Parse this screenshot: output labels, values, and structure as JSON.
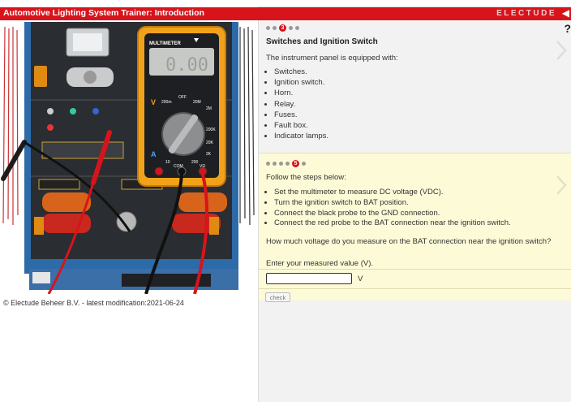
{
  "header": {
    "title": "Automotive Lighting System Trainer: Introduction",
    "brand": "ELECTUDE",
    "help_label": "?"
  },
  "figure": {
    "meter_label": "MULTIMETER",
    "display_value": "0.00",
    "dial_labels": [
      "V",
      "200m",
      "OFF",
      "20M",
      "2M",
      "200K",
      "20K",
      "2K",
      "200",
      "A",
      "10",
      "COM",
      "VΩ"
    ]
  },
  "footer": {
    "copyright": "© Electude Beheer B.V. - latest modification:2021-06-24"
  },
  "panel1": {
    "step_active": "3",
    "heading": "Switches and Ignition Switch",
    "intro": "The instrument panel is equipped with:",
    "items": [
      "Switches.",
      "Ignition switch.",
      "Horn.",
      "Relay.",
      "Fuses.",
      "Fault box.",
      "Indicator lamps."
    ]
  },
  "panel2": {
    "step_active": "5",
    "intro": "Follow the steps below:",
    "steps": [
      "Set the multimeter to measure DC voltage (VDC).",
      "Turn the ignition switch to BAT position.",
      "Connect the black probe to the GND connection.",
      "Connect the red probe to the BAT connection near the ignition switch."
    ],
    "question": "How much voltage do you measure on the BAT connection near the ignition switch?",
    "instruction": "Enter your measured value (V).",
    "input_value": "",
    "unit": "V",
    "check_label": "check"
  },
  "colors": {
    "brand_red": "#d7141c",
    "panel_yellow": "#fdfbd7",
    "panel_grey": "#f2f2f2"
  }
}
